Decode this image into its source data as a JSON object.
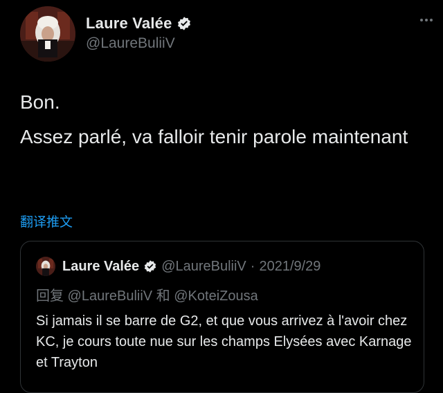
{
  "tweet": {
    "author": {
      "display_name": "Laure Valée",
      "handle": "@LaureBuliiV",
      "verified": true,
      "avatar_icon": "judge-wig-avatar"
    },
    "text_line_1": "Bon.",
    "text_line_2": "Assez parlé, va falloir tenir parole maintenant",
    "translate_link": "翻译推文",
    "more_icon": "ellipsis-icon"
  },
  "quoted_tweet": {
    "author": {
      "display_name": "Laure Valée",
      "handle": "@LaureBuliiV",
      "verified": true
    },
    "separator": "·",
    "date": "2021/9/29",
    "reply_to": "回复 @LaureBuliiV 和 @KoteiZousa",
    "text": "Si jamais il se barre de G2, et que vous arrivez à l'avoir chez KC, je cours toute nue sur les champs Elysées avec Karnage et Trayton"
  },
  "colors": {
    "background": "#000000",
    "text_primary": "#e7e9ea",
    "text_secondary": "#71767b",
    "link": "#1d9bf0",
    "verified_badge": "#e7e9ea",
    "border": "#2f3336"
  }
}
